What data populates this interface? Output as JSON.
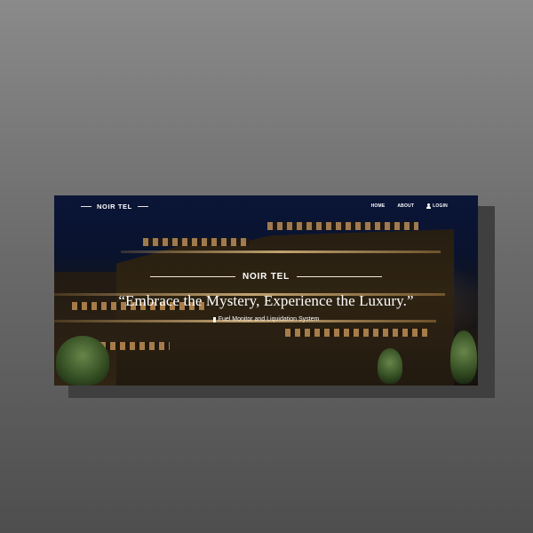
{
  "nav": {
    "brand": "NOIR TEL",
    "links": [
      {
        "label": "HOME"
      },
      {
        "label": "ABOUT"
      },
      {
        "label": "LOGIN",
        "icon": "user-icon"
      }
    ]
  },
  "hero": {
    "brand": "NOIR TEL",
    "headline": "“Embrace the Mystery, Experience the Luxury.”",
    "subtitle": "Fuel Monitor and Liquidation System",
    "subtitle_icon": "fuel-icon"
  },
  "colors": {
    "sky": "#0e1a44",
    "accent_light": "#ffd896",
    "text": "#ffffff"
  }
}
